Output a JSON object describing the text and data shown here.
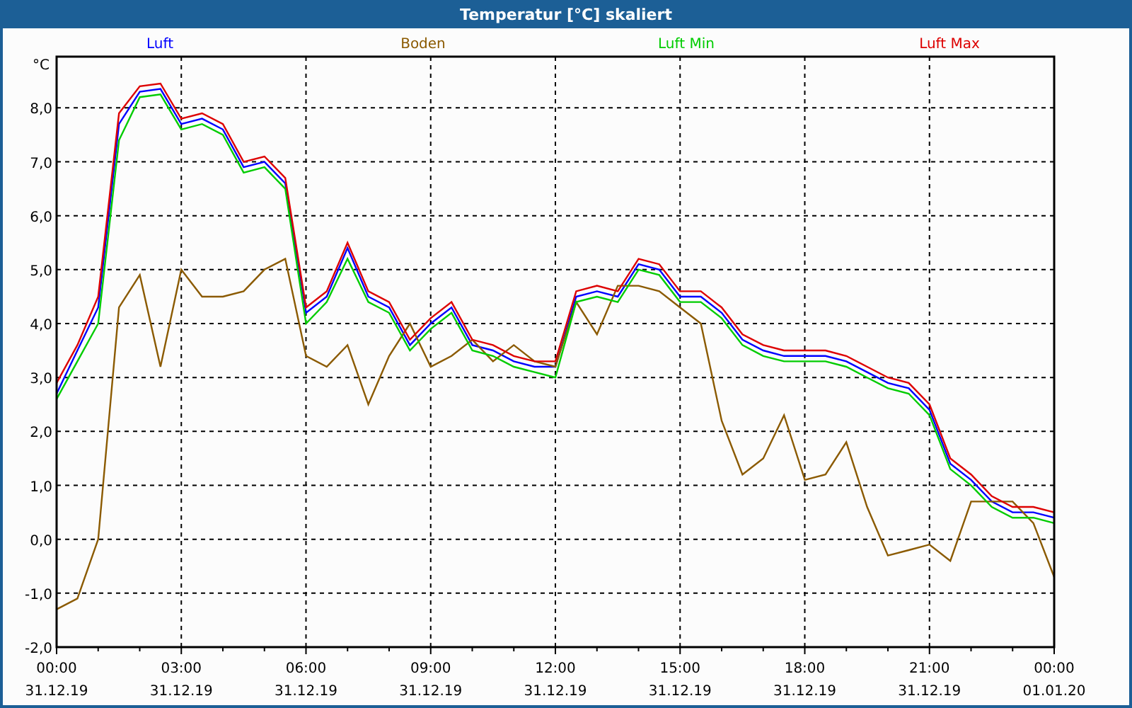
{
  "window": {
    "title": "Temperatur [°C] skaliert"
  },
  "chart": {
    "chart_data": {
      "type": "line",
      "ylabel": "°C",
      "categories": [
        "00:00\n31.12.19",
        null,
        null,
        null,
        null,
        null,
        "03:00\n31.12.19",
        null,
        null,
        null,
        null,
        null,
        "06:00\n31.12.19",
        null,
        null,
        null,
        null,
        null,
        "09:00\n31.12.19",
        null,
        null,
        null,
        null,
        null,
        "12:00\n31.12.19",
        null,
        null,
        null,
        null,
        null,
        "15:00\n31.12.19",
        null,
        null,
        null,
        null,
        null,
        "18:00\n31.12.19",
        null,
        null,
        null,
        null,
        null,
        "21:00\n31.12.19",
        null,
        null,
        null,
        null,
        null,
        "00:00\n01.01.20"
      ],
      "series": [
        {
          "name": "Luft",
          "color": "#0000ff",
          "values": [
            2.7,
            3.5,
            4.3,
            7.7,
            8.3,
            8.35,
            7.7,
            7.8,
            7.6,
            6.9,
            7.0,
            6.6,
            4.2,
            4.5,
            5.4,
            4.5,
            4.3,
            3.6,
            4.0,
            4.3,
            3.6,
            3.5,
            3.3,
            3.2,
            3.2,
            4.5,
            4.6,
            4.5,
            5.1,
            5.0,
            4.5,
            4.5,
            4.2,
            3.7,
            3.5,
            3.4,
            3.4,
            3.4,
            3.3,
            3.1,
            2.9,
            2.8,
            2.4,
            1.4,
            1.1,
            0.7,
            0.5,
            0.5,
            0.4
          ]
        },
        {
          "name": "Boden",
          "color": "#8b5a00",
          "values": [
            -1.3,
            -1.1,
            0.0,
            4.3,
            4.9,
            3.2,
            5.0,
            4.5,
            4.5,
            4.6,
            5.0,
            5.2,
            3.4,
            3.2,
            3.6,
            2.5,
            3.4,
            4.0,
            3.2,
            3.4,
            3.7,
            3.3,
            3.6,
            3.3,
            3.2,
            4.4,
            3.8,
            4.7,
            4.7,
            4.6,
            4.3,
            4.0,
            2.2,
            1.2,
            1.5,
            2.3,
            1.1,
            1.2,
            1.8,
            0.6,
            -0.3,
            -0.2,
            -0.1,
            -0.4,
            0.7,
            0.7,
            0.7,
            0.3,
            -0.7
          ]
        },
        {
          "name": "Luft Min",
          "color": "#00cc00",
          "values": [
            2.6,
            3.3,
            4.0,
            7.4,
            8.2,
            8.25,
            7.6,
            7.7,
            7.5,
            6.8,
            6.9,
            6.5,
            4.0,
            4.4,
            5.2,
            4.4,
            4.2,
            3.5,
            3.9,
            4.2,
            3.5,
            3.4,
            3.2,
            3.1,
            3.0,
            4.4,
            4.5,
            4.4,
            5.0,
            4.9,
            4.4,
            4.4,
            4.1,
            3.6,
            3.4,
            3.3,
            3.3,
            3.3,
            3.2,
            3.0,
            2.8,
            2.7,
            2.3,
            1.3,
            1.0,
            0.6,
            0.4,
            0.4,
            0.3
          ]
        },
        {
          "name": "Luft Max",
          "color": "#dd0000",
          "values": [
            2.9,
            3.6,
            4.5,
            7.9,
            8.4,
            8.45,
            7.8,
            7.9,
            7.7,
            7.0,
            7.1,
            6.7,
            4.3,
            4.6,
            5.5,
            4.6,
            4.4,
            3.7,
            4.1,
            4.4,
            3.7,
            3.6,
            3.4,
            3.3,
            3.3,
            4.6,
            4.7,
            4.6,
            5.2,
            5.1,
            4.6,
            4.6,
            4.3,
            3.8,
            3.6,
            3.5,
            3.5,
            3.5,
            3.4,
            3.2,
            3.0,
            2.9,
            2.5,
            1.5,
            1.2,
            0.8,
            0.6,
            0.6,
            0.5
          ]
        }
      ],
      "grid": true,
      "ylim": [
        -2,
        8.95
      ],
      "yticks": [
        {
          "value": -2,
          "label": "-2,0"
        },
        {
          "value": -1,
          "label": "-1,0"
        },
        {
          "value": 0,
          "label": "0,0"
        },
        {
          "value": 1,
          "label": "1,0"
        },
        {
          "value": 2,
          "label": "2,0"
        },
        {
          "value": 3,
          "label": "3,0"
        },
        {
          "value": 4,
          "label": "4,0"
        },
        {
          "value": 5,
          "label": "5,0"
        },
        {
          "value": 6,
          "label": "6,0"
        },
        {
          "value": 7,
          "label": "7,0"
        },
        {
          "value": 8,
          "label": "8,0"
        }
      ]
    }
  }
}
